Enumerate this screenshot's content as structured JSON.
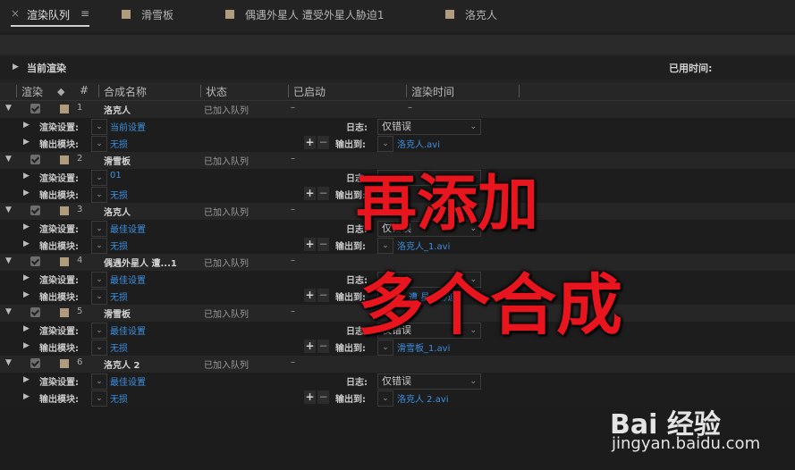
{
  "tabs": {
    "active": "渲染队列",
    "items": [
      "滑雪板",
      "偶遇外星人 遭受外星人胁迫1",
      "洛克人"
    ],
    "swatch_color": "#b09c7d"
  },
  "current": {
    "label": "当前渲染",
    "elapsed_label": "已用时间:"
  },
  "columns": {
    "render": "渲染",
    "num": "#",
    "comp": "合成名称",
    "status": "状态",
    "started": "已启动",
    "time": "渲染时间"
  },
  "sub_labels": {
    "render_settings": "渲染设置:",
    "output_module": "输出模块:",
    "log": "日志:",
    "output_to": "输出到:"
  },
  "buttons": {
    "plus": "+",
    "minus": "−"
  },
  "items": [
    {
      "num": "1",
      "name": "洛克人",
      "status": "已加入队列",
      "started": "–",
      "time": "–",
      "settings": "当前设置",
      "module": "无损",
      "log": "仅错误",
      "output": "洛克人.avi"
    },
    {
      "num": "2",
      "name": "滑雪板",
      "status": "已加入队列",
      "started": "–",
      "time": "",
      "settings": "01",
      "module": "无损",
      "log": "",
      "output": ""
    },
    {
      "num": "3",
      "name": "洛克人",
      "status": "已加入队列",
      "started": "–",
      "time": "",
      "settings": "最佳设置",
      "module": "无损",
      "log": "仅错误",
      "output": "洛克人_1.avi"
    },
    {
      "num": "4",
      "name": "偶遇外星人 遭...1",
      "status": "已加入队列",
      "started": "–",
      "time": "",
      "settings": "最佳设置",
      "module": "无损",
      "log": "",
      "output": "人 遭 星人胁迫"
    },
    {
      "num": "5",
      "name": "滑雪板",
      "status": "已加入队列",
      "started": "–",
      "time": "",
      "settings": "最佳设置",
      "module": "无损",
      "log": "仅错误",
      "output": "滑雪板_1.avi"
    },
    {
      "num": "6",
      "name": "洛克人 2",
      "status": "已加入队列",
      "started": "–",
      "time": "",
      "settings": "最佳设置",
      "module": "无损",
      "log": "仅错误",
      "output": "洛克人 2.avi"
    }
  ],
  "overlay": {
    "line1": "再添加",
    "line2": "多个合成"
  },
  "watermark": {
    "brand": "Bai 经验",
    "url": "jingyan.baidu.com"
  },
  "colors": {
    "accent_red": "#e8141e",
    "link_blue": "#3a8fe0"
  }
}
